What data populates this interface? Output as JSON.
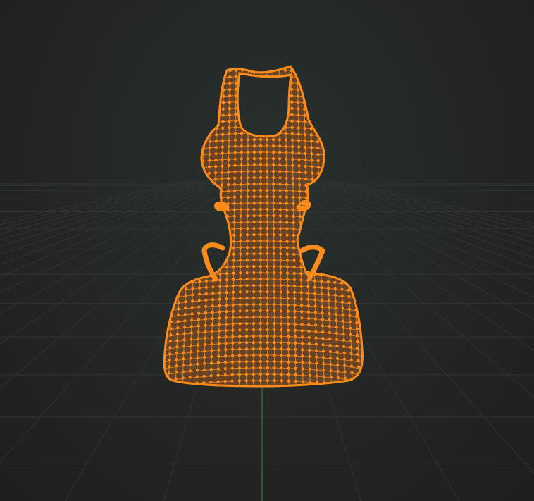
{
  "viewport": {
    "background_color": "#232625",
    "grid_line_color": "#2f3432",
    "y_axis_color": "#2e8a3f"
  },
  "mesh": {
    "object_type": "dress",
    "mode": "edit-mode-selected",
    "fill_color": "#6b4527",
    "wire_color": "#e07d1c",
    "vertex_color": "#ff8c1a"
  }
}
